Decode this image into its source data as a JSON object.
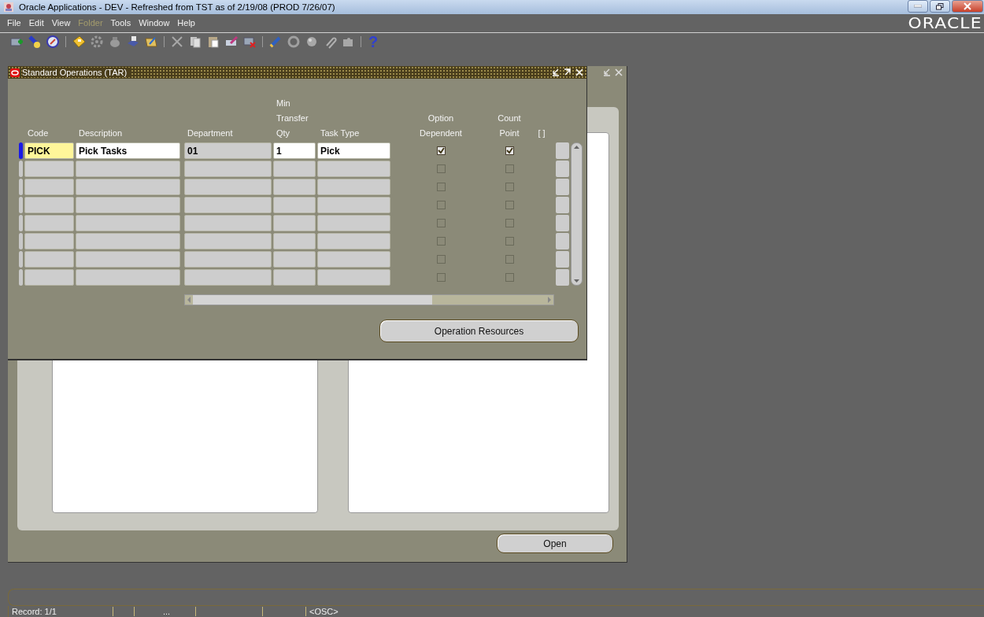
{
  "app_window": {
    "title": "Oracle Applications - DEV - Refreshed from TST as of 2/19/08 (PROD 7/26/07)"
  },
  "menu": [
    {
      "label": "File",
      "disabled": false
    },
    {
      "label": "Edit",
      "disabled": false
    },
    {
      "label": "View",
      "disabled": false
    },
    {
      "label": "Folder",
      "disabled": true
    },
    {
      "label": "Tools",
      "disabled": false
    },
    {
      "label": "Window",
      "disabled": false
    },
    {
      "label": "Help",
      "disabled": false
    }
  ],
  "brand": "ORACLE",
  "toolbar": {
    "help_label": "?"
  },
  "background_window": {
    "button": "Open"
  },
  "form_window": {
    "title": "Standard Operations (TAR)",
    "columns": [
      {
        "label": "Code"
      },
      {
        "label": "Description"
      },
      {
        "label": "Department"
      },
      {
        "label": "Min Transfer Qty"
      },
      {
        "label": "Task Type"
      },
      {
        "label": "Option Dependent"
      },
      {
        "label": "Count Point"
      },
      {
        "label": "[ ]"
      }
    ],
    "rows": [
      {
        "current": true,
        "code": "PICK",
        "description": "Pick Tasks",
        "department": "01",
        "min_transfer_qty": "1",
        "task_type": "Pick",
        "option_dependent": true,
        "count_point": true
      },
      {
        "current": false,
        "option_dependent": false,
        "count_point": false
      },
      {
        "current": false,
        "option_dependent": false,
        "count_point": false
      },
      {
        "current": false,
        "option_dependent": false,
        "count_point": false
      },
      {
        "current": false,
        "option_dependent": false,
        "count_point": false
      },
      {
        "current": false,
        "option_dependent": false,
        "count_point": false
      },
      {
        "current": false,
        "option_dependent": false,
        "count_point": false
      },
      {
        "current": false,
        "option_dependent": false,
        "count_point": false
      }
    ],
    "button": "Operation Resources"
  },
  "status_bar": {
    "record": "Record: 1/1",
    "ellipsis": "...",
    "mode": "<OSC>"
  }
}
